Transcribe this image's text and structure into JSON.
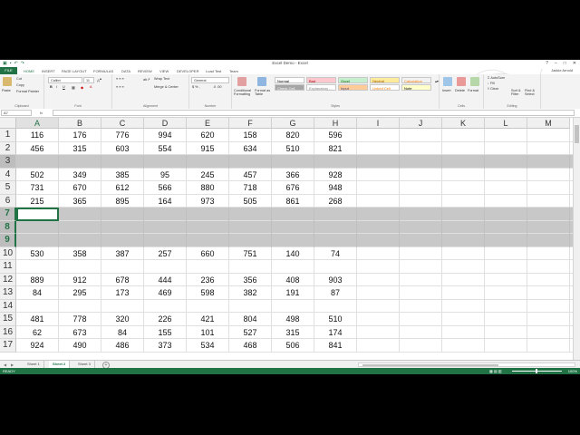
{
  "window": {
    "title": "Excel Demo - Excel",
    "controls": [
      "?",
      "–",
      "□",
      "✕"
    ]
  },
  "ribbon": {
    "file_label": "FILE",
    "tabs": [
      "HOME",
      "INSERT",
      "PAGE LAYOUT",
      "FORMULAS",
      "DATA",
      "REVIEW",
      "VIEW",
      "DEVELOPER",
      "Load Test",
      "Team"
    ],
    "user": "Jackie Arnold",
    "clipboard": {
      "paste": "Paste",
      "cut": "Cut",
      "copy": "Copy",
      "format_painter": "Format Painter",
      "label": "Clipboard"
    },
    "font": {
      "name": "Calibri",
      "size": "11",
      "label": "Font",
      "bold": "B",
      "italic": "I",
      "underline": "U"
    },
    "alignment": {
      "wrap": "Wrap Text",
      "merge": "Merge & Center",
      "label": "Alignment"
    },
    "number": {
      "format": "General",
      "label": "Number"
    },
    "styles": {
      "conditional": "Conditional Formatting",
      "format_table": "Format as Table",
      "cells": [
        {
          "text": "Normal",
          "bg": "#ffffff",
          "fg": "#000000"
        },
        {
          "text": "Bad",
          "bg": "#ffc7ce",
          "fg": "#9c0006"
        },
        {
          "text": "Good",
          "bg": "#c6efce",
          "fg": "#006100"
        },
        {
          "text": "Neutral",
          "bg": "#ffeb9c",
          "fg": "#9c5700"
        },
        {
          "text": "Calculation",
          "bg": "#f2f2f2",
          "fg": "#fa7d00"
        },
        {
          "text": "Check Cell",
          "bg": "#a5a5a5",
          "fg": "#ffffff"
        },
        {
          "text": "Explanatory ...",
          "bg": "#ffffff",
          "fg": "#7f7f7f"
        },
        {
          "text": "Input",
          "bg": "#ffcc99",
          "fg": "#3f3f76"
        },
        {
          "text": "Linked Cell",
          "bg": "#ffffff",
          "fg": "#fa7d00"
        },
        {
          "text": "Note",
          "bg": "#ffffcc",
          "fg": "#000000"
        }
      ],
      "label": "Styles"
    },
    "cells_group": {
      "insert": "Insert",
      "delete": "Delete",
      "format": "Format",
      "label": "Cells"
    },
    "editing": {
      "autosum": "AutoSum",
      "fill": "Fill",
      "clear": "Clear",
      "sort": "Sort & Filter",
      "find": "Find & Select",
      "label": "Editing"
    }
  },
  "formula_bar": {
    "name_box": "A7",
    "fx": "fx",
    "content": ""
  },
  "columns": [
    "A",
    "B",
    "C",
    "D",
    "E",
    "F",
    "G",
    "H",
    "I",
    "J",
    "K",
    "L",
    "M"
  ],
  "rows": [
    {
      "n": "1",
      "grey": false,
      "cells": [
        "116",
        "176",
        "776",
        "994",
        "620",
        "158",
        "820",
        "596"
      ]
    },
    {
      "n": "2",
      "grey": false,
      "cells": [
        "456",
        "315",
        "603",
        "554",
        "915",
        "634",
        "510",
        "821"
      ]
    },
    {
      "n": "3",
      "grey": true,
      "cells": []
    },
    {
      "n": "4",
      "grey": false,
      "cells": [
        "502",
        "349",
        "385",
        "95",
        "245",
        "457",
        "366",
        "928"
      ]
    },
    {
      "n": "5",
      "grey": false,
      "cells": [
        "731",
        "670",
        "612",
        "566",
        "880",
        "718",
        "676",
        "948"
      ]
    },
    {
      "n": "6",
      "grey": false,
      "cells": [
        "215",
        "365",
        "895",
        "164",
        "973",
        "505",
        "861",
        "268"
      ]
    },
    {
      "n": "7",
      "grey": true,
      "cells": []
    },
    {
      "n": "8",
      "grey": true,
      "cells": []
    },
    {
      "n": "9",
      "grey": true,
      "cells": []
    },
    {
      "n": "10",
      "grey": false,
      "cells": [
        "530",
        "358",
        "387",
        "257",
        "660",
        "751",
        "140",
        "74"
      ]
    },
    {
      "n": "11",
      "grey": false,
      "cells": []
    },
    {
      "n": "12",
      "grey": false,
      "cells": [
        "889",
        "912",
        "678",
        "444",
        "236",
        "356",
        "408",
        "903"
      ]
    },
    {
      "n": "13",
      "grey": false,
      "cells": [
        "84",
        "295",
        "173",
        "469",
        "598",
        "382",
        "191",
        "87"
      ]
    },
    {
      "n": "14",
      "grey": false,
      "cells": []
    },
    {
      "n": "15",
      "grey": false,
      "cells": [
        "481",
        "778",
        "320",
        "226",
        "421",
        "804",
        "498",
        "510"
      ]
    },
    {
      "n": "16",
      "grey": false,
      "cells": [
        "62",
        "673",
        "84",
        "155",
        "101",
        "527",
        "315",
        "174"
      ]
    },
    {
      "n": "17",
      "grey": false,
      "cells": [
        "924",
        "490",
        "486",
        "373",
        "534",
        "468",
        "506",
        "841"
      ]
    }
  ],
  "selected_rows": [
    "7",
    "8",
    "9"
  ],
  "sheets": [
    {
      "name": "Sheet 1",
      "active": false
    },
    {
      "name": "Sheet 2",
      "active": true
    },
    {
      "name": "Sheet 3",
      "active": false
    }
  ],
  "status": {
    "ready": "READY",
    "zoom": "100%"
  },
  "colors": {
    "accent": "#217346",
    "selection_grey": "#c8c8c8"
  }
}
